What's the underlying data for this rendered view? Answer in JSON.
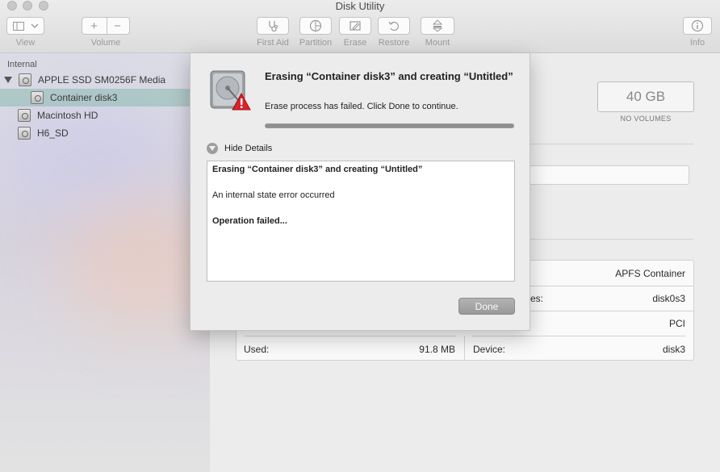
{
  "window": {
    "title": "Disk Utility"
  },
  "toolbar": {
    "view_label": "View",
    "volume_label": "Volume",
    "volume_add": "+",
    "volume_remove": "−",
    "first_aid_label": "First Aid",
    "partition_label": "Partition",
    "erase_label": "Erase",
    "restore_label": "Restore",
    "mount_label": "Mount",
    "info_label": "Info"
  },
  "sidebar": {
    "section": "Internal",
    "items": [
      {
        "label": "APPLE SSD SM0256F Media"
      },
      {
        "label": "Container disk3"
      },
      {
        "label": "Macintosh HD"
      },
      {
        "label": "H6_SD"
      }
    ]
  },
  "main": {
    "capacity": "40 GB",
    "capacity_label": "NO VOLUMES",
    "info": {
      "type_value": "APFS Container",
      "row2_label_fragment": "es:",
      "row2_value": "disk0s3",
      "row3_value": "PCI",
      "used_label": "Used:",
      "used_value": "91.8 MB",
      "device_label": "Device:",
      "device_value": "disk3"
    }
  },
  "dialog": {
    "title": "Erasing “Container disk3” and creating “Untitled”",
    "message": "Erase process has failed. Click Done to continue.",
    "progress": 1.0,
    "details_toggle": "Hide Details",
    "details": {
      "line1": "Erasing “Container disk3” and creating “Untitled”",
      "line2": "An internal state error occurred",
      "line3": "Operation failed..."
    },
    "done_button": "Done"
  },
  "icons": [
    "sidebar-toggle-icon",
    "chevron-down-icon",
    "stethoscope-icon",
    "pie-chart-icon",
    "eraser-icon",
    "restore-arrow-icon",
    "mount-icon",
    "info-icon",
    "disk-icon",
    "error-badge-icon",
    "disclosure-triangle-icon"
  ]
}
